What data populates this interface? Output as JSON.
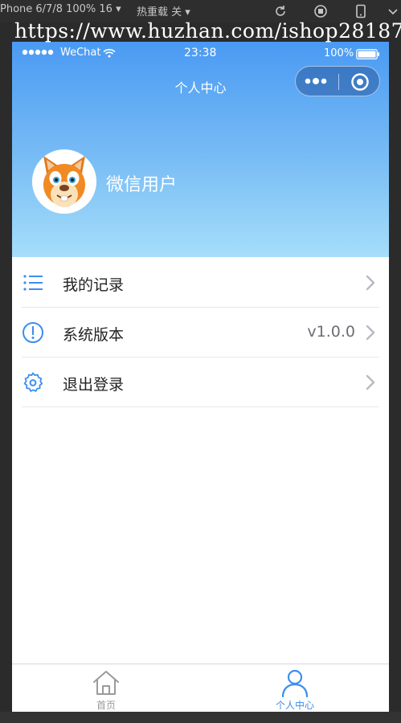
{
  "ide": {
    "device": "Phone 6/7/8 100% 16 ▾",
    "hot_reload": "热重载 关 ▾",
    "watermark": "https://www.huzhan.com/ishop28187"
  },
  "status_bar": {
    "carrier": "WeChat",
    "time": "23:38",
    "battery": "100%"
  },
  "nav": {
    "title": "个人中心"
  },
  "profile": {
    "username": "微信用户"
  },
  "menu": [
    {
      "label": "我的记录",
      "value": "",
      "icon": "list-icon"
    },
    {
      "label": "系统版本",
      "value": "v1.0.0",
      "icon": "info-icon"
    },
    {
      "label": "退出登录",
      "value": "",
      "icon": "settings-gear-icon"
    }
  ],
  "tabbar": {
    "tabs": [
      {
        "label": "首页",
        "active": false,
        "icon": "home-icon"
      },
      {
        "label": "个人中心",
        "active": true,
        "icon": "user-icon"
      }
    ],
    "active_color": "#3c8ef0",
    "inactive_color": "#999999"
  },
  "colors": {
    "accent": "#3c8ef0",
    "header_top": "#4a9af3",
    "header_bottom": "#a6defa"
  }
}
